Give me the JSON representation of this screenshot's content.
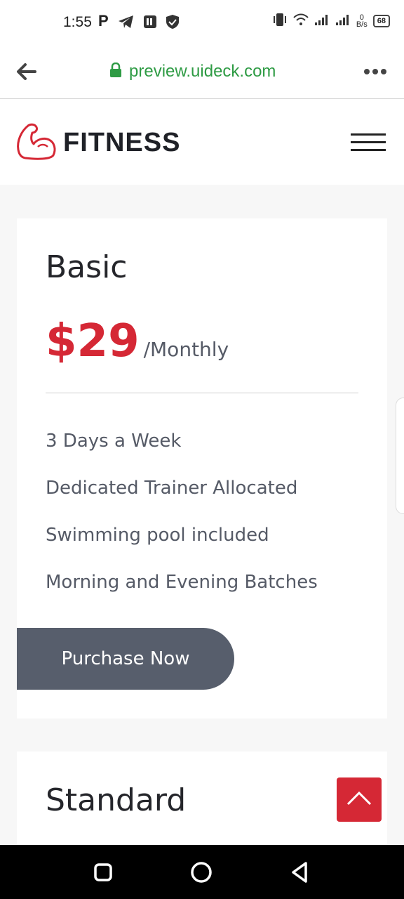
{
  "status_bar": {
    "time": "1:55",
    "icons": [
      "p-icon",
      "telegram-icon",
      "sim-icon",
      "shield-icon",
      "vibrate-icon",
      "wifi-icon",
      "signal-icon",
      "signal-icon"
    ],
    "net_speed_value": "0",
    "net_speed_unit": "B/s",
    "battery": "68"
  },
  "browser": {
    "url": "preview.uideck.com",
    "secure_color": "#2e9b44"
  },
  "header": {
    "logo_text": "FITNESS",
    "brand_color": "#d52835"
  },
  "plans": [
    {
      "name": "Basic",
      "price": "$29",
      "period": "/Monthly",
      "features": [
        "3 Days a Week",
        "Dedicated Trainer Allocated",
        "Swimming pool included",
        "Morning and Evening Batches"
      ],
      "cta": "Purchase Now"
    },
    {
      "name": "Standard"
    }
  ],
  "colors": {
    "accent": "#d52835",
    "button": "#575e6c",
    "text": "#555a66"
  }
}
